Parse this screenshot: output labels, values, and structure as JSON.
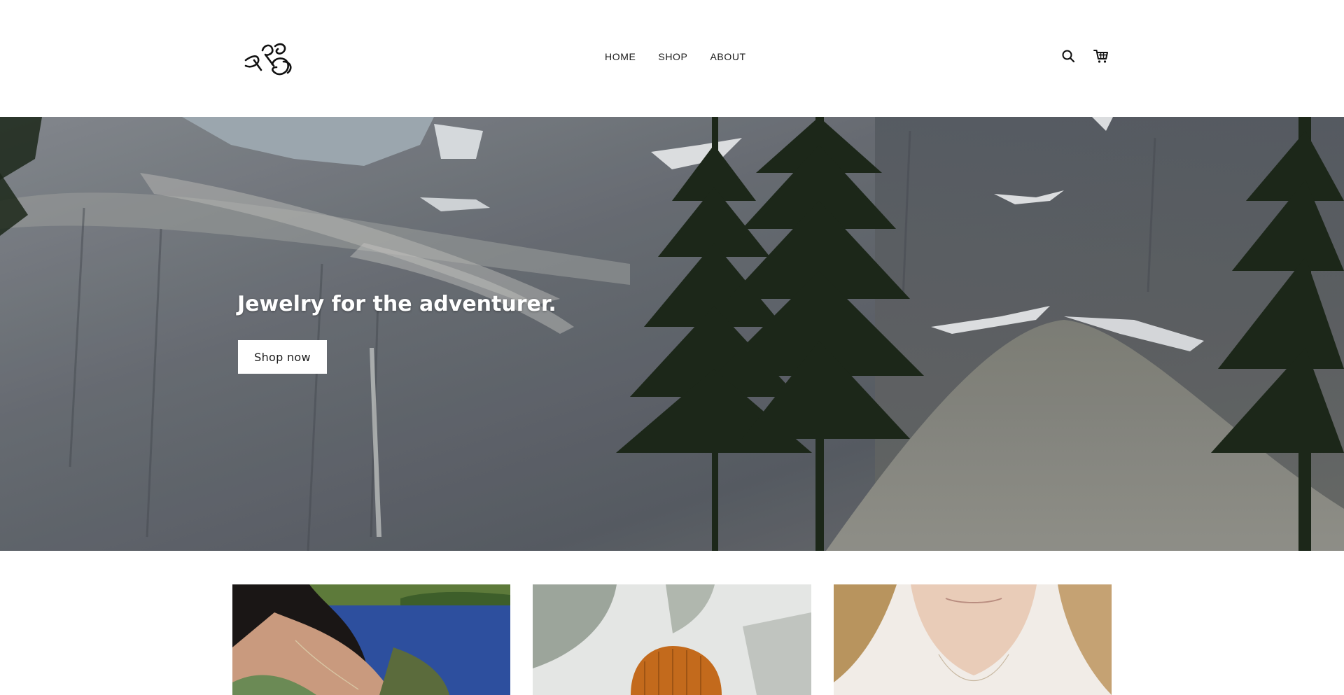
{
  "header": {
    "logo_alt": "Dross",
    "nav": [
      {
        "label": "HOME"
      },
      {
        "label": "SHOP"
      },
      {
        "label": "ABOUT"
      }
    ],
    "icons": {
      "search": "search-icon",
      "cart": "cart-icon"
    }
  },
  "hero": {
    "title": "Jewelry for the adventurer.",
    "button_label": "Shop now",
    "image": "mountain-cliff-with-pine-trees"
  },
  "collections": [
    {
      "image": "woman-necklace-by-lake"
    },
    {
      "image": "person-orange-beanie"
    },
    {
      "image": "woman-necklace-closeup"
    }
  ]
}
